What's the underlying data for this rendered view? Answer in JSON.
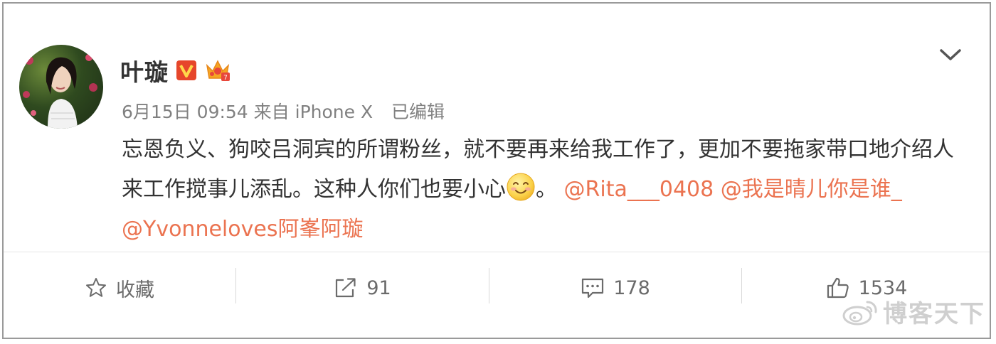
{
  "post": {
    "username": "叶璇",
    "meta": {
      "timestamp": "6月15日 09:54",
      "source": "来自 iPhone X",
      "edited": "已编辑"
    },
    "content": {
      "text": "忘恩负义、狗咬吕洞宾的所谓粉丝，就不要再来给我工作了，更加不要拖家带口地介绍人来工作搅事儿添乱。这种人你们也要小心",
      "after_emoji": "。",
      "mentions": [
        "@Rita___0408",
        "@我是晴儿你是谁_",
        "@Yvonneloves阿峯阿璇"
      ],
      "emoji": "smiling-face-emoji"
    },
    "icons": {
      "verified": "verified-v-badge-icon",
      "member": "crown-member-icon",
      "menu": "chevron-down-icon"
    }
  },
  "actions": {
    "favorite": {
      "label": "收藏",
      "icon": "star-icon"
    },
    "repost": {
      "count": "91",
      "icon": "share-arrow-icon"
    },
    "comment": {
      "count": "178",
      "icon": "comment-icon"
    },
    "like": {
      "count": "1534",
      "icon": "thumbs-up-icon"
    }
  },
  "watermark": {
    "text": "博客天下",
    "icon": "weibo-logo-icon"
  },
  "colors": {
    "mention": "#eb7350",
    "text": "#333333",
    "meta": "#808080",
    "badge": "#e64a19",
    "crown": "#f5a623"
  }
}
